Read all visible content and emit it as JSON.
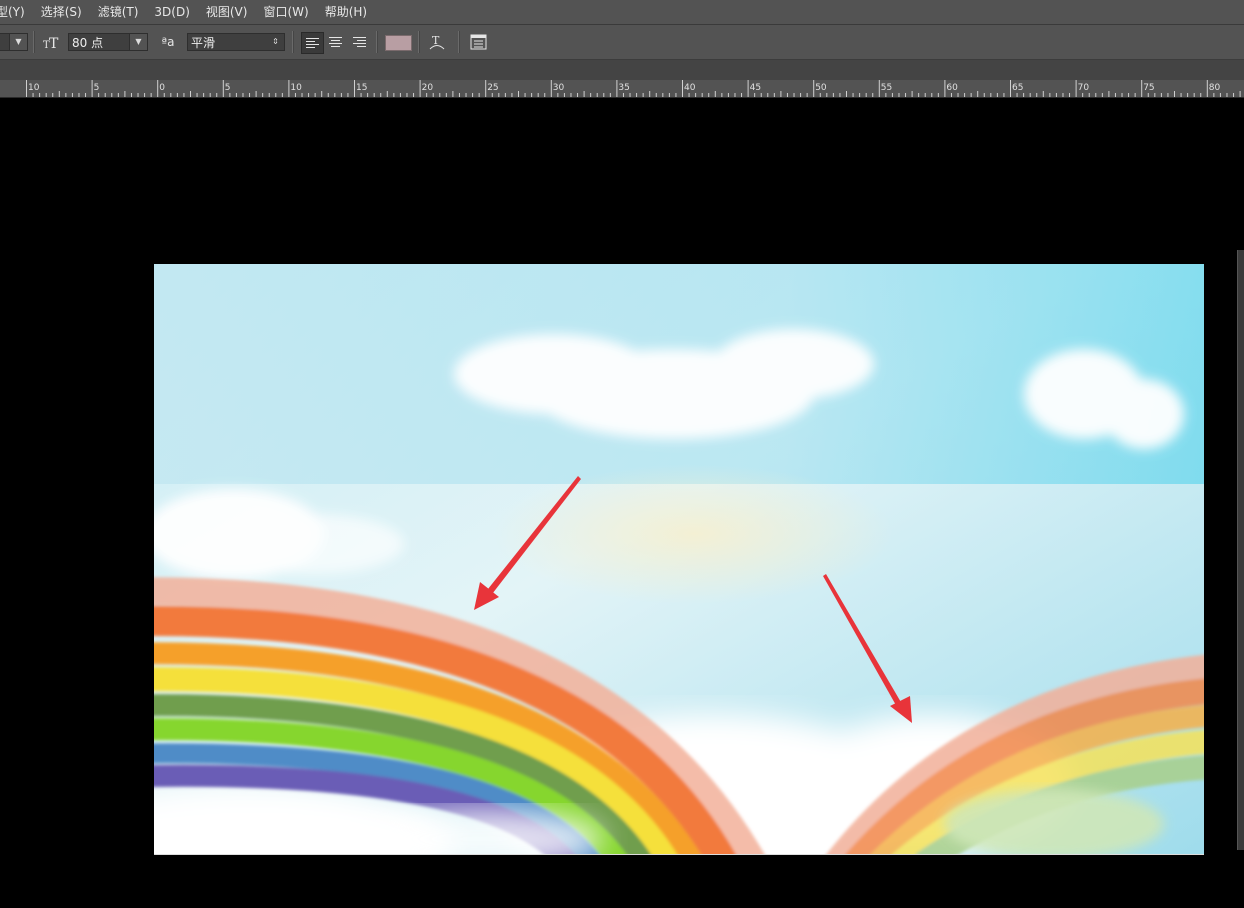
{
  "menu": {
    "items": [
      "型(Y)",
      "选择(S)",
      "滤镜(T)",
      "3D(D)",
      "视图(V)",
      "窗口(W)",
      "帮助(H)"
    ]
  },
  "options_bar": {
    "font_size": "80 点",
    "antialias_label_glyph": "ªa",
    "antialias_value": "平滑",
    "text_color": "#b89ea3",
    "icons": [
      "text-orientation-icon",
      "align-left-icon",
      "align-center-icon",
      "align-right-icon",
      "warp-text-icon",
      "character-panel-icon"
    ]
  },
  "ruler": {
    "labels": [
      "10",
      "5",
      "0",
      "5",
      "10",
      "15",
      "20",
      "25",
      "30",
      "35",
      "40",
      "45",
      "50",
      "55",
      "60",
      "65",
      "70",
      "75",
      "80"
    ]
  },
  "document": {
    "subject": "rainbow-sky-illustration",
    "annotations": [
      "red-arrow-left",
      "red-arrow-right"
    ],
    "colors": {
      "sky_top": "#61d5ec",
      "sky_light": "#e6f6fa",
      "arrow": "#e8343a"
    }
  }
}
